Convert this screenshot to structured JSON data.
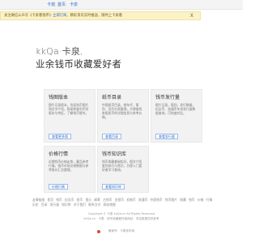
{
  "nav": {
    "items": [
      "卡泉",
      "首页",
      "卡泉"
    ]
  },
  "notice": {
    "text_before": "关注微信公众号《卡泉看钱币》",
    "link": "立即订阅",
    "text_after": "，精彩资讯实时推送，随时上卡泉看",
    "close": "X"
  },
  "hero": {
    "line1": "kkQa·卡泉,",
    "line2": "业余钱币收藏爱好者"
  },
  "cards": [
    {
      "title": "钱图版本",
      "desc": "图片记录版本，包括钱币图片和文字介绍，帮助你鉴别不同版本与特征，了解钱币细节。",
      "button": "查看更多版"
    },
    {
      "title": "纸币目录",
      "desc": "中国纸币目录，按年代、版别、冠号分类整理，方便查找各版纸币的详细信息与参考价格。",
      "button": "查看目录"
    },
    {
      "title": "钱币发行量",
      "desc": "图片记录，版别，发行数量，纪念币、流通币年份发行量数据查询，可快速对比。",
      "button": "查看发行量"
    },
    {
      "title": "价格行情",
      "desc": "近期钱币价格走势，藏品参考行情，钱币市场交易数据与参考报价汇总整理。",
      "button": "价格行情"
    },
    {
      "title": "钱币知识库",
      "desc": "钱币收藏基础知识，图文介绍鉴别技巧与常识，方便入门爱好者学习查阅。",
      "button": "查看知识库"
    }
  ],
  "links": [
    "友情链接",
    "首页",
    "钱币",
    "纪念币",
    "纸币",
    "银元",
    "邮票",
    "古钱币",
    "金银币",
    "机制币",
    "流通币",
    "外国钱币",
    "钱币图片",
    "收藏",
    "钱币",
    "价格",
    "行情",
    "历史",
    "目录",
    "发行量",
    "知识库",
    "关于我们",
    "联系方式",
    "网站地图"
  ],
  "footer": {
    "line1": "Copyright © 卡泉 kkQa.cn All Rights Reserved",
    "line2": "kkQa.cn · 卡泉 · 钱币收藏爱好者网站 · 本站数据仅供参考",
    "line3": "备案号：卡泉钱币网"
  }
}
